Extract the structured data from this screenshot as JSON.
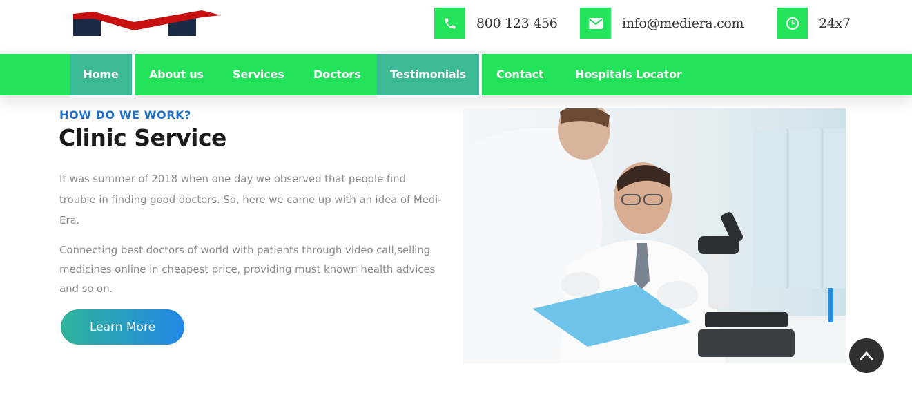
{
  "header": {
    "phone": {
      "icon": "phone-icon",
      "text": "800 123 456"
    },
    "email": {
      "icon": "envelope-icon",
      "text": "info@mediera.com"
    },
    "hours": {
      "icon": "clock-icon",
      "text": "24x7"
    }
  },
  "nav": {
    "items": [
      {
        "label": "Home",
        "active": true
      },
      {
        "label": "About us",
        "active": false
      },
      {
        "label": "Services",
        "active": false
      },
      {
        "label": "Doctors",
        "active": false
      },
      {
        "label": "Testimonials",
        "active": true
      },
      {
        "label": "Contact",
        "active": false
      },
      {
        "label": "Hospitals Locator",
        "active": false
      }
    ]
  },
  "main": {
    "eyebrow": "HOW DO WE WORK?",
    "title": "Clinic Service",
    "paragraph1": "It was summer of 2018 when one day we observed that people find trouble in finding good doctors. So, here we came up with an idea of Medi-Era.",
    "paragraph2": "Connecting best doctors of world with patients through video call,selling medicines online in cheapest price, providing must known health advices and so on.",
    "button_label": "Learn More"
  },
  "colors": {
    "nav_bg": "#22e35a",
    "nav_active": "#3cba98",
    "eyebrow": "#1f6fc5",
    "button_gradient_start": "#2fb39a",
    "button_gradient_end": "#2187e6",
    "logo_red": "#c81010",
    "logo_navy": "#1b2a45"
  },
  "scroll_top": {
    "icon": "chevron-up-icon"
  }
}
